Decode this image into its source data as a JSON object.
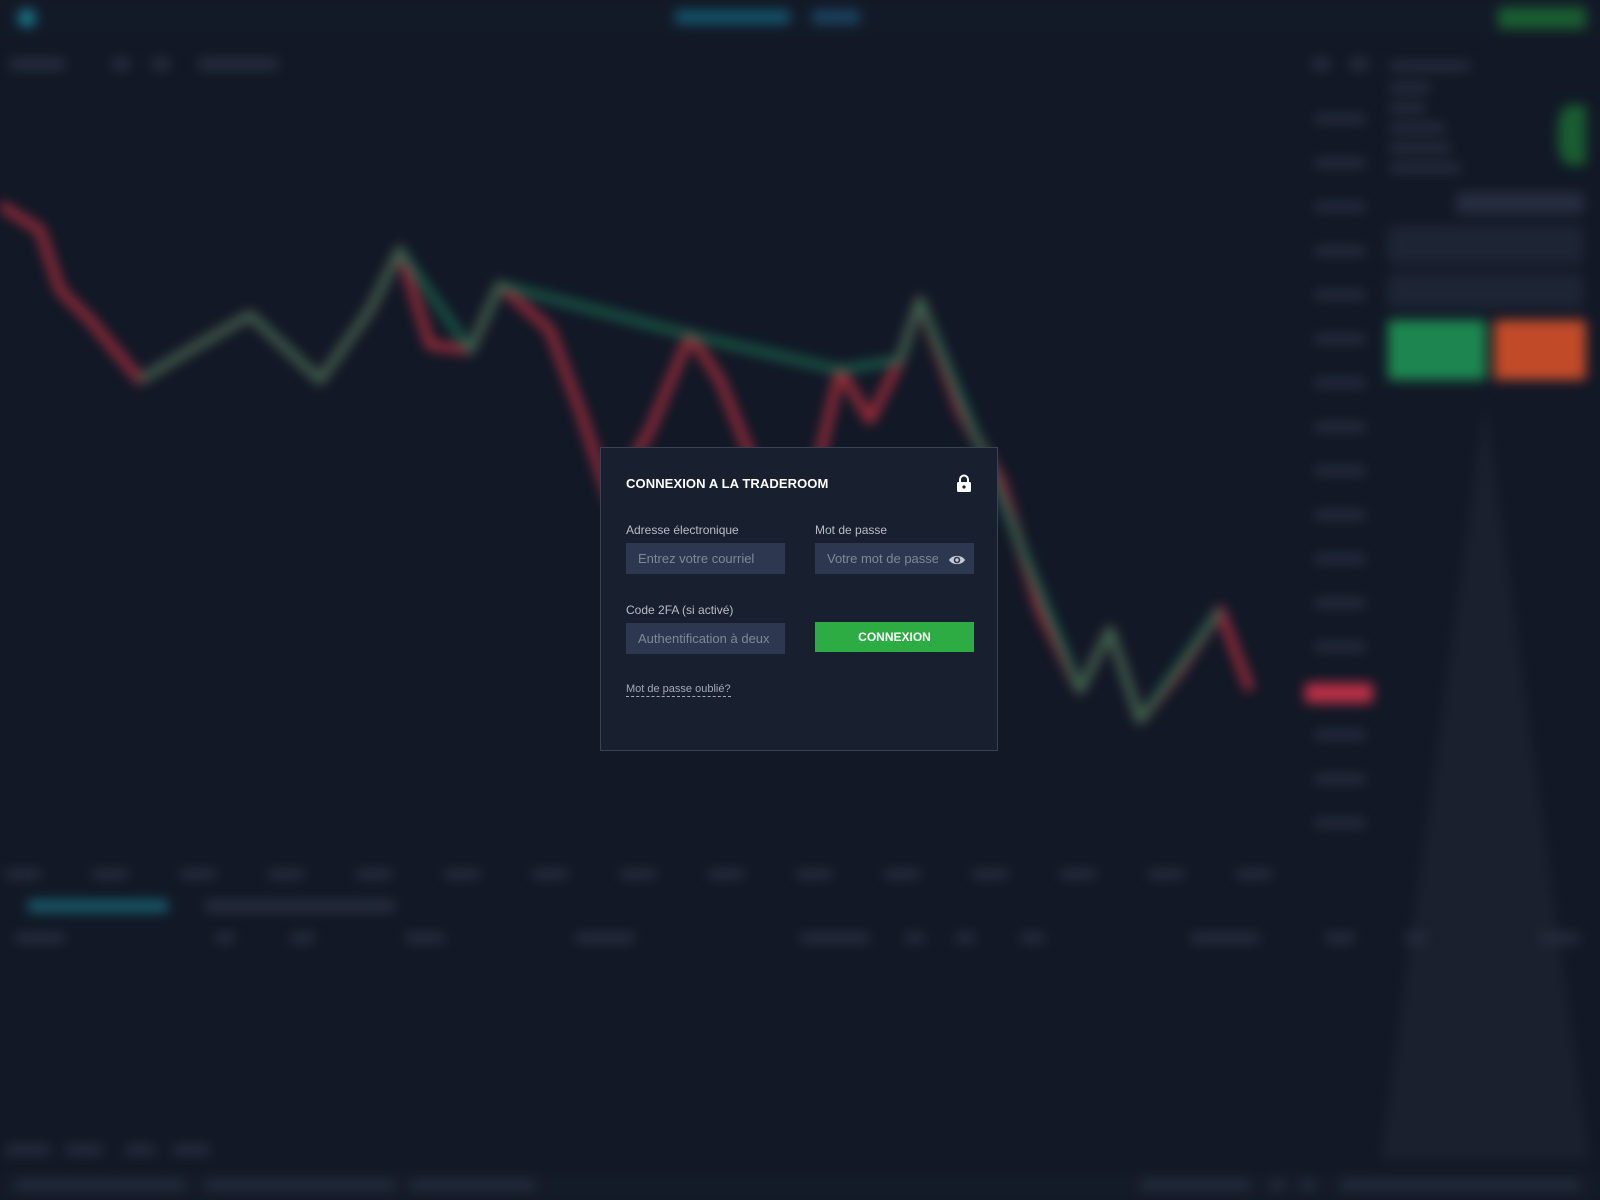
{
  "modal": {
    "title": "CONNEXION A LA TRADEROOM",
    "email": {
      "label": "Adresse électronique",
      "placeholder": "Entrez votre courriel",
      "value": ""
    },
    "password": {
      "label": "Mot de passe",
      "placeholder": "Votre mot de passe",
      "value": ""
    },
    "twofa": {
      "label": "Code 2FA (si activé)",
      "placeholder": "Authentification à deux facteurs",
      "value": ""
    },
    "submit_label": "CONNEXION",
    "forgot_label": "Mot de passe oublié?"
  },
  "icons": {
    "lock": "lock-icon",
    "eye": "eye-icon"
  },
  "colors": {
    "background": "#121826",
    "modal": "#182030",
    "input": "#2e3750",
    "primary_button": "#2eac44",
    "candle_up": "#1f8a5e",
    "candle_down": "#b8303f",
    "sell": "#e0542a",
    "price_marker": "#d8344c"
  }
}
